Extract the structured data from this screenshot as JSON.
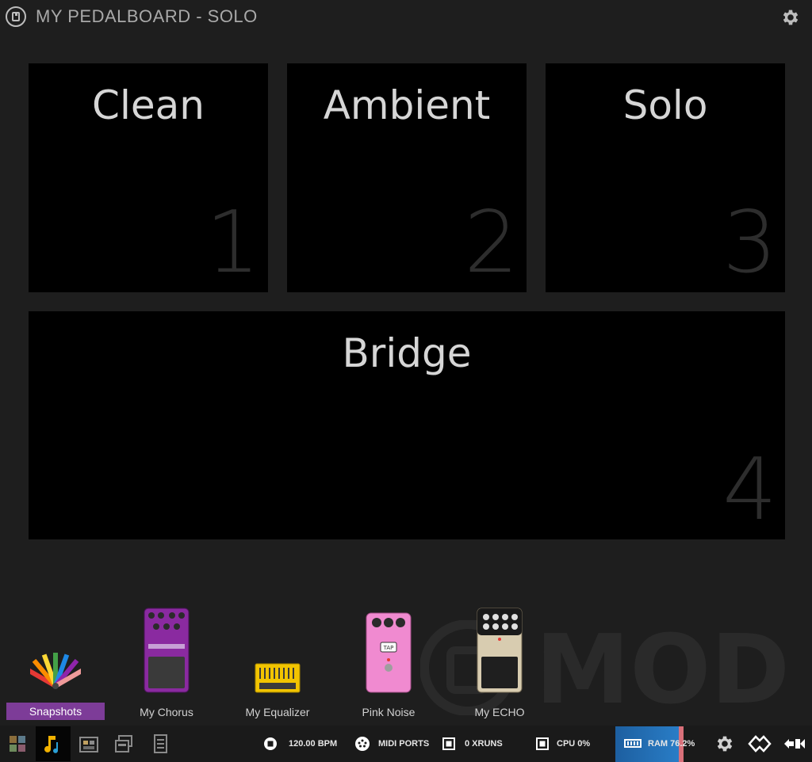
{
  "header": {
    "title": "MY PEDALBOARD - SOLO"
  },
  "snapshots": [
    {
      "name": "Clean",
      "number": "1"
    },
    {
      "name": "Ambient",
      "number": "2"
    },
    {
      "name": "Solo",
      "number": "3"
    },
    {
      "name": "Bridge",
      "number": "4"
    }
  ],
  "shelf": {
    "snapshots_label": "Snapshots",
    "pedals": [
      {
        "label": "My Chorus",
        "color": "#8a2aa0"
      },
      {
        "label": "My Equalizer",
        "color": "#f2c400"
      },
      {
        "label": "Pink Noise",
        "color": "#f08ad0"
      },
      {
        "label": "My ECHO",
        "color": "#d8ccb0"
      }
    ]
  },
  "watermark": {
    "text": "MOD"
  },
  "statusbar": {
    "bpm": "120.00 BPM",
    "midi": "MIDI PORTS",
    "xruns": "0 XRUNS",
    "cpu": "CPU 0%",
    "ram": "RAM 76.2%"
  },
  "colors": {
    "background": "#1e1e1e",
    "tile": "#000000",
    "snapshot_accent": "#7d3c98",
    "ram_bar": "#2a7fc9"
  }
}
